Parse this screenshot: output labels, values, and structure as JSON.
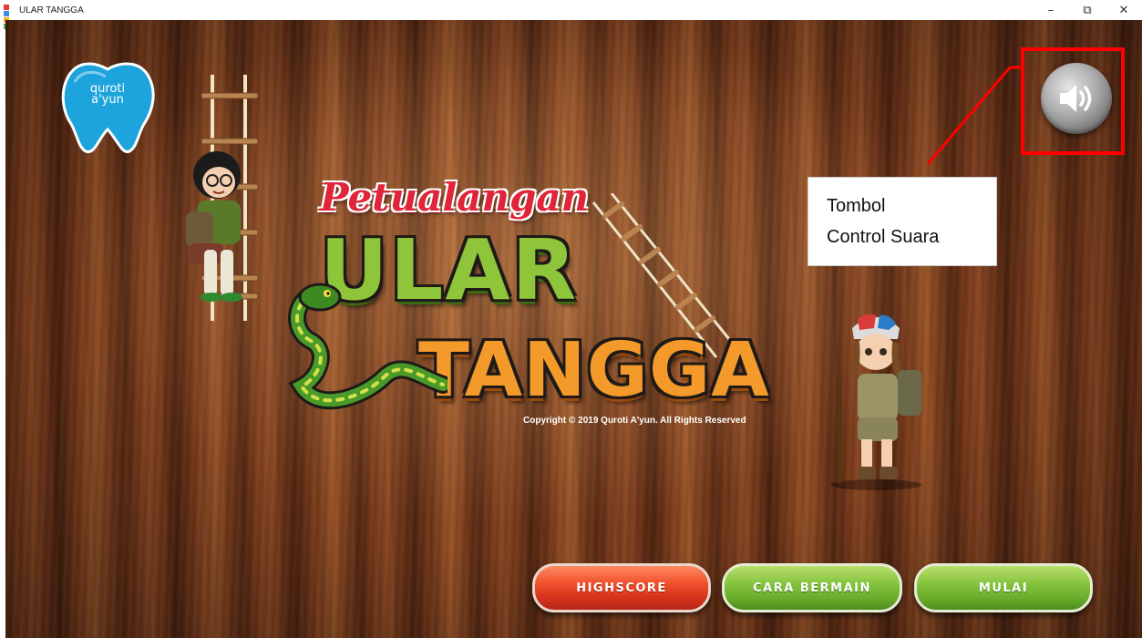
{
  "window": {
    "title": "ULAR TANGGA",
    "app_icon": "app-window-icon",
    "controls": {
      "minimize": "–",
      "restore": "⧉",
      "close": "✕"
    }
  },
  "logo": {
    "line1": "quroti",
    "line2": "a'yun"
  },
  "title": {
    "small": "Petualangan",
    "line1": "ULAR",
    "line2": "TANGGA"
  },
  "copyright": "Copyright © 2019 Quroti A'yun. All Rights Reserved",
  "sound_button": {
    "icon": "speaker-icon"
  },
  "annotation": {
    "line1": "Tombol",
    "line2": "Control Suara"
  },
  "buttons": {
    "highscore": "HIGHSCORE",
    "cara_bermain": "CARA BERMAIN",
    "mulai": "MULAI"
  },
  "colors": {
    "wood": "#7a3a1a",
    "title_red": "#e0243a",
    "ular_green": "#8ec53a",
    "tangga_orange": "#f39a2a",
    "annotation_red": "#ff0000",
    "button_red": "#f0502a",
    "button_green": "#85c43e"
  }
}
